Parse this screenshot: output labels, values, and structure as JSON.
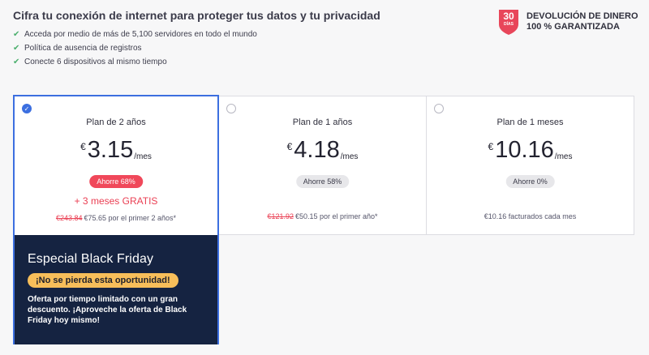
{
  "header": {
    "headline": "Cifra tu conexión de internet para proteger tus datos y tu privacidad",
    "features": [
      "Acceda por medio de más de 5,100 servidores en todo el mundo",
      "Política de ausencia de registros",
      "Conecte 6 dispositivos al mismo tiempo"
    ]
  },
  "guarantee": {
    "number": "30",
    "days": "DÍAS",
    "line1": "DEVOLUCIÓN DE DINERO",
    "line2": "100 % GARANTIZADA",
    "color": "#e8465a"
  },
  "plans": [
    {
      "title": "Plan de 2 años",
      "currency": "€",
      "price": "3.15",
      "per": "/mes",
      "saving": "Ahorre 68%",
      "bonus": "+ 3 meses GRATIS",
      "old_price": "€243.84",
      "footnote": "€75.65 por el primer 2 años*",
      "selected": true
    },
    {
      "title": "Plan de 1 años",
      "currency": "€",
      "price": "4.18",
      "per": "/mes",
      "saving": "Ahorre 58%",
      "old_price": "€121.92",
      "footnote": "€50.15 por el primer año*",
      "selected": false
    },
    {
      "title": "Plan de 1 meses",
      "currency": "€",
      "price": "10.16",
      "per": "/mes",
      "saving": "Ahorre 0%",
      "footnote": "€10.16 facturados cada mes",
      "selected": false
    }
  ],
  "promo": {
    "title": "Especial Black Friday",
    "badge": "¡No se pierda esta oportunidad!",
    "text": "Oferta por tiempo limitado con un gran descuento. ¡Aproveche la oferta de Black Friday hoy mismo!"
  },
  "colors": {
    "accent": "#3c6fe0",
    "sale": "#f0485a",
    "promo_bg": "#152341",
    "promo_badge": "#f7be5a",
    "check": "#4caf6e"
  }
}
